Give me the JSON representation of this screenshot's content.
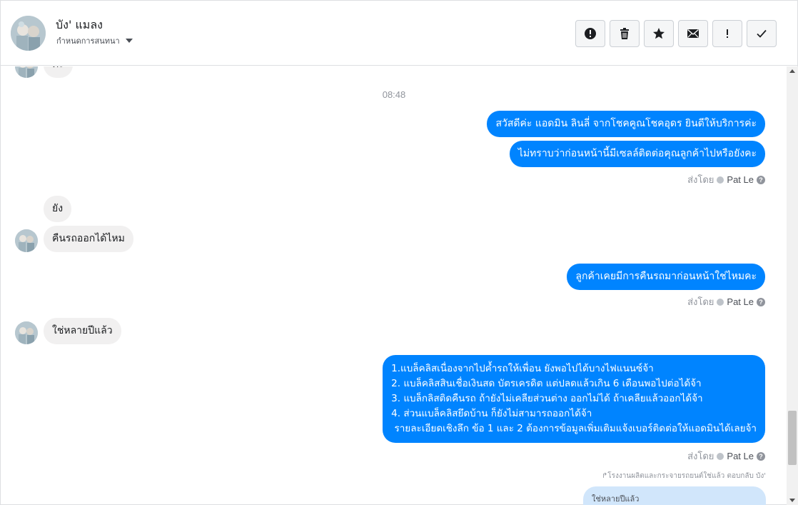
{
  "header": {
    "contact_name": "บัง' แมลง",
    "assign_label": "กำหนดการสนทนา",
    "toolbar": [
      {
        "name": "spam-button",
        "icon": "exclamation-circle-icon"
      },
      {
        "name": "delete-button",
        "icon": "trash-icon"
      },
      {
        "name": "star-button",
        "icon": "star-icon"
      },
      {
        "name": "mark-unread-button",
        "icon": "envelope-icon"
      },
      {
        "name": "follow-up-button",
        "icon": "exclamation-icon"
      },
      {
        "name": "done-button",
        "icon": "checkmark-icon"
      }
    ]
  },
  "conversation": {
    "top_partial_text": "ค่ะ",
    "timestamp": "08:48",
    "messages": {
      "out1": "สวัสดีค่ะ แอดมิน ลินลี่ จากโชคคูณโชคอุดร ยินดีให้บริการค่ะ",
      "out2": "ไม่ทราบว่าก่อนหน้านี้มีเซลล์ติดต่อคุณลูกค้าไปหรือยังคะ",
      "in1": "ยัง",
      "in2": "คืนรถออกได้ไหม",
      "out3": "ลูกค้าเคยมีการคืนรถมาก่อนหน้าใช่ไหมคะ",
      "in3": "ใช่หลายปีแล้ว",
      "out4": "1.แบล็คลิสเนื่องจากไปค้ำรถให้เพื่อน ยังพอไปได้บางไฟแนนซ์จ้า\n2. แบล็คลิสสินเชื่อเงินสด บัตรเครดิต แต่ปลดแล้วเกิน 6 เดือนพอไปต่อได้จ้า\n3. แบล็กลิสติดคืนรถ ถ้ายังไม่เคลียส่วนต่าง ออกไม่ได้ ถ้าเคลียแล้วออกได้จ้า\n4. ส่วนแบล็คลิสยึดบ้าน ก็ยังไม่สามารถออกได้จ้า\n รายละเอียดเชิงลึก ข้อ 1 และ 2 ต้องการข้อมูลเพิ่มเติมแจ้งเบอร์ติดต่อให้แอดมินได้เลยจ้า"
    },
    "sent_by_label": "ส่งโดย",
    "sent_by_name": "Pat Le",
    "reply_note": "โรงงานผลิตและกระจายรถยนต์ใช่แล้ว ตอบกลับ บัง'",
    "reply_preview": "ใช่หลายปีแล้ว"
  },
  "colors": {
    "outgoing": "#0084ff",
    "incoming": "#f1f0f0",
    "reply": "#d1e6fb"
  }
}
